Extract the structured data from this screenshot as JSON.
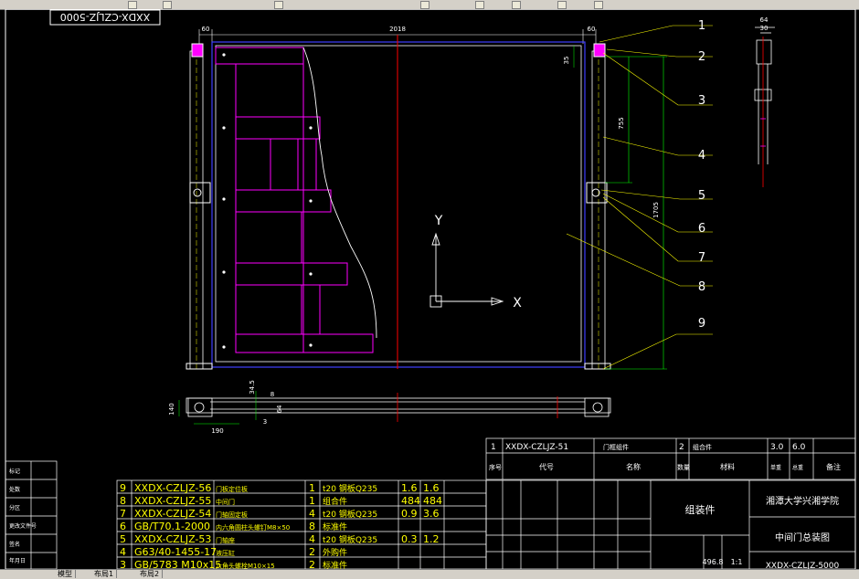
{
  "window": {
    "title": "XXDX-CZLJZ-5000 中间门总装图"
  },
  "toolbar": {
    "buttons": [
      "toolbar-button-1",
      "toolbar-button-2",
      "toolbar-button-3",
      "toolbar-button-4",
      "toolbar-button-5",
      "toolbar-button-6",
      "toolbar-button-7",
      "toolbar-button-8"
    ]
  },
  "drawing": {
    "stamp_code": "XXDX-CZLJZ-5000",
    "dims": {
      "top_left": "60",
      "top_total": "2018",
      "top_right": "60",
      "left_35": "35",
      "v_755": "755",
      "v_1705": "1705",
      "side_64": "64",
      "side_30": "30",
      "bottom_140": "140",
      "bottom_190": "190",
      "bottom_345": "34.5",
      "bottom_8": "8",
      "bottom_64": "64",
      "bottom_3": "3"
    },
    "balloons": [
      "1",
      "2",
      "3",
      "4",
      "5",
      "6",
      "7",
      "8",
      "9"
    ],
    "ucs": {
      "x_label": "X",
      "y_label": "Y"
    }
  },
  "title_block": {
    "row1": {
      "no": "1",
      "code": "XXDX-CZLJZ-51",
      "name": "门框组件",
      "qty": "2",
      "material": "组合件",
      "w1": "3.0",
      "w2": "6.0"
    },
    "header": {
      "no": "序号",
      "code": "代号",
      "name": "名称",
      "qty": "数量",
      "material": "材料",
      "unit": "单重",
      "total": "总重",
      "note": "备注"
    },
    "school": "湘潭大学兴湘学院",
    "drawing_name": "中间门总装图",
    "assembly": "组装件",
    "weight": "496.8",
    "scale": "1:1",
    "bottom_code": "XXDX-CZLJZ-5000"
  },
  "bom": [
    {
      "no": "9",
      "code": "XXDX-CZLJZ-56",
      "name": "门板定位板",
      "qty": "1",
      "material": "t20 钢板Q235",
      "w1": "1.6",
      "w2": "1.6"
    },
    {
      "no": "8",
      "code": "XXDX-CZLJZ-55",
      "name": "中间门",
      "qty": "1",
      "material": "组合件",
      "w1": "484",
      "w2": "484"
    },
    {
      "no": "7",
      "code": "XXDX-CZLJZ-54",
      "name": "门轴固定板",
      "qty": "4",
      "material": "t20 钢板Q235",
      "w1": "0.9",
      "w2": "3.6"
    },
    {
      "no": "6",
      "code": "GB/T70.1-2000",
      "name": "内六角圆柱头螺钉M8×50",
      "qty": "8",
      "material": "标准件",
      "w1": "",
      "w2": ""
    },
    {
      "no": "5",
      "code": "XXDX-CZLJZ-53",
      "name": "门轴座",
      "qty": "4",
      "material": "t20 钢板Q235",
      "w1": "0.3",
      "w2": "1.2"
    },
    {
      "no": "4",
      "code": "G63/40-1455-17",
      "name": "液压缸",
      "qty": "2",
      "material": "外购件",
      "w1": "",
      "w2": ""
    },
    {
      "no": "3",
      "code": "GB/5783 M10x15",
      "name": "六角头螺栓M10×15",
      "qty": "2",
      "material": "标准件",
      "w1": "",
      "w2": ""
    }
  ],
  "left_block": [
    "标记",
    "处数",
    "分区",
    "更改文件号",
    "签名",
    "年月日"
  ],
  "status": {
    "tabs": [
      "模型",
      "布局1",
      "布局2"
    ]
  },
  "colors": {
    "bg": "#000000",
    "frame": "#ffffff",
    "magenta": "#ff00ff",
    "yellow": "#ffff00",
    "green": "#00ff00",
    "red": "#ff0000",
    "blue": "#0000ff"
  }
}
